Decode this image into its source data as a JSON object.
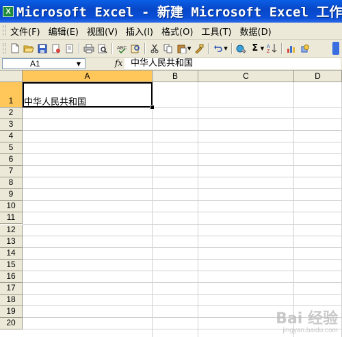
{
  "window": {
    "title": "Microsoft Excel - 新建 Microsoft Excel 工作表",
    "app_icon": "excel-icon"
  },
  "menu": [
    {
      "label": "文件(F)"
    },
    {
      "label": "编辑(E)"
    },
    {
      "label": "视图(V)"
    },
    {
      "label": "插入(I)"
    },
    {
      "label": "格式(O)"
    },
    {
      "label": "工具(T)"
    },
    {
      "label": "数据(D)"
    }
  ],
  "toolbar": {
    "buttons": [
      "new-icon",
      "open-icon",
      "save-icon",
      "permission-icon",
      "print-preview-icon",
      "print-icon",
      "preview-icon",
      "spelling-icon",
      "research-icon",
      "cut-icon",
      "copy-icon",
      "paste-icon",
      "format-painter-icon",
      "undo-icon",
      "hyperlink-icon",
      "autosum-icon",
      "sort-ascending-icon",
      "chart-wizard-icon",
      "drawing-icon"
    ],
    "autosum_glyph": "Σ",
    "sort_glyph": "A↓Z"
  },
  "formula_bar": {
    "name_box": "A1",
    "fx": "fx",
    "value": "中华人民共和国"
  },
  "sheet": {
    "columns": [
      "A",
      "B",
      "C",
      "D"
    ],
    "active_column": "A",
    "rows": [
      "1",
      "2",
      "3",
      "4",
      "5",
      "6",
      "7",
      "8",
      "9",
      "10",
      "11",
      "12",
      "13",
      "14",
      "15",
      "16",
      "17",
      "18",
      "19",
      "20"
    ],
    "active_row": "1",
    "cells": {
      "A1": "中华人民共和国"
    }
  },
  "watermark": {
    "text": "Bai 经验",
    "subtext": "jingyan.baidu.com"
  },
  "colors": {
    "titlebar": "#0a4fd8",
    "chrome": "#ece9d8",
    "active_header": "#ffc65a",
    "gridline": "#d0d0d0"
  }
}
